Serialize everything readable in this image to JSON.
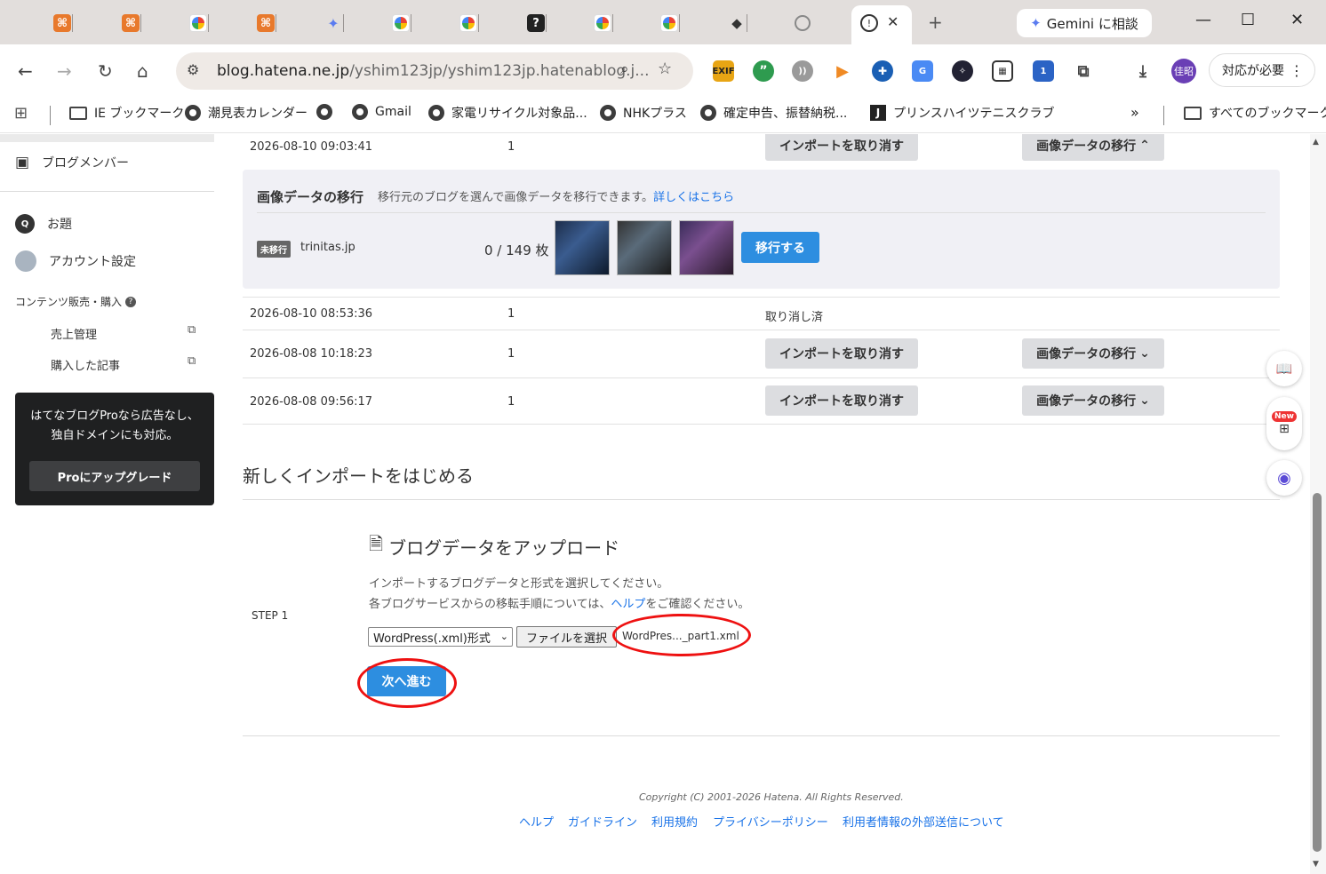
{
  "browser": {
    "tabs": [
      {
        "icon": "hatena"
      },
      {
        "icon": "hatena"
      },
      {
        "icon": "google"
      },
      {
        "icon": "hatena"
      },
      {
        "icon": "gemini"
      },
      {
        "icon": "google"
      },
      {
        "icon": "google"
      },
      {
        "icon": "question"
      },
      {
        "icon": "google"
      },
      {
        "icon": "google"
      },
      {
        "icon": "pin"
      },
      {
        "icon": "web"
      }
    ],
    "gemini_label": "Gemini に相談",
    "url_host": "blog.hatena.ne.jp",
    "url_path": "/yshim123jp/yshim123jp.hatenablog.j...",
    "profile_initials": "佳昭",
    "action_required": "対応が必要",
    "ext_badge": "1",
    "ext_exif": "EXIF",
    "bookmarks": [
      "IE ブックマーク",
      "潮見表カレンダー",
      "Gmail",
      "家電リサイクル対象品...",
      "NHKプラス",
      "確定申告、振替納税...",
      "プリンスハイツテニスクラブ"
    ],
    "all_bookmarks": "すべてのブックマーク"
  },
  "sidebar": {
    "blog_members": "ブログメンバー",
    "topics": "お題",
    "account_settings": "アカウント設定",
    "content_sales": "コンテンツ販売・購入",
    "sales_mgmt": "売上管理",
    "purchased": "購入した記事",
    "pro_text": "はてなブログProなら広告なし、独自ドメインにも対応。",
    "pro_button": "Proにアップグレード"
  },
  "imports": {
    "cancel_label": "インポートを取り消す",
    "migrate_label": "画像データの移行",
    "rows": [
      {
        "date": "2026-08-10 09:03:41",
        "count": "1"
      },
      {
        "date": "2026-08-10 08:53:36",
        "count": "1",
        "status": "取り消し済"
      },
      {
        "date": "2026-08-08 10:18:23",
        "count": "1"
      },
      {
        "date": "2026-08-08 09:56:17",
        "count": "1"
      }
    ]
  },
  "migration_panel": {
    "title": "画像データの移行",
    "desc": "移行元のブログを選んで画像データを移行できます。",
    "link": "詳しくはこちら",
    "badge": "未移行",
    "source": "trinitas.jp",
    "progress": "0 / 149 枚",
    "button": "移行する"
  },
  "new_import": {
    "title": "新しくインポートをはじめる",
    "step": "STEP 1",
    "heading": "ブログデータをアップロード",
    "line1": "インポートするブログデータと形式を選択してください。",
    "line2_pre": "各ブログサービスからの移転手順については、",
    "line2_link": "ヘルプ",
    "line2_post": "をご確認ください。",
    "format_selected": "WordPress(.xml)形式",
    "file_button": "ファイルを選択",
    "file_name": "WordPres..._part1.xml",
    "next_button": "次へ進む"
  },
  "footer": {
    "copyright": "Copyright (C) 2001-2026 Hatena. All Rights Reserved.",
    "links": [
      "ヘルプ",
      "ガイドライン",
      "利用規約",
      "プライバシーポリシー",
      "利用者情報の外部送信について"
    ]
  },
  "float": {
    "new_badge": "New"
  },
  "colors": {
    "accent": "#2d8ee0",
    "annotation": "#e11111",
    "link": "#1a73e8"
  }
}
